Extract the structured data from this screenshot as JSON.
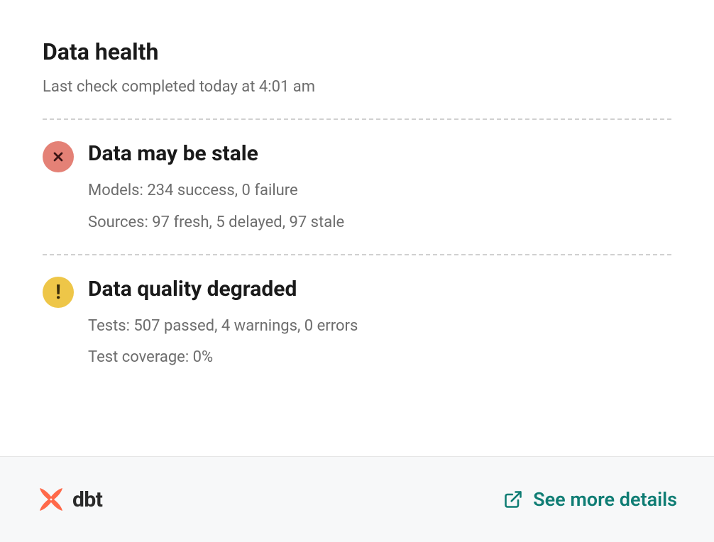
{
  "header": {
    "title": "Data health",
    "last_check": "Last check completed today at 4:01 am"
  },
  "statuses": [
    {
      "icon": "error",
      "heading": "Data may be stale",
      "lines": [
        "Models: 234 success, 0 failure",
        "Sources: 97 fresh, 5 delayed, 97 stale"
      ]
    },
    {
      "icon": "warning",
      "heading": "Data quality degraded",
      "lines": [
        "Tests: 507 passed, 4 warnings, 0 errors",
        "Test coverage: 0%"
      ]
    }
  ],
  "footer": {
    "logo_text": "dbt",
    "details_label": "See more details"
  },
  "colors": {
    "error_bg": "#e48176",
    "warning_bg": "#eec648",
    "link": "#0f7d74",
    "footer_bg": "#f7f8f9"
  }
}
